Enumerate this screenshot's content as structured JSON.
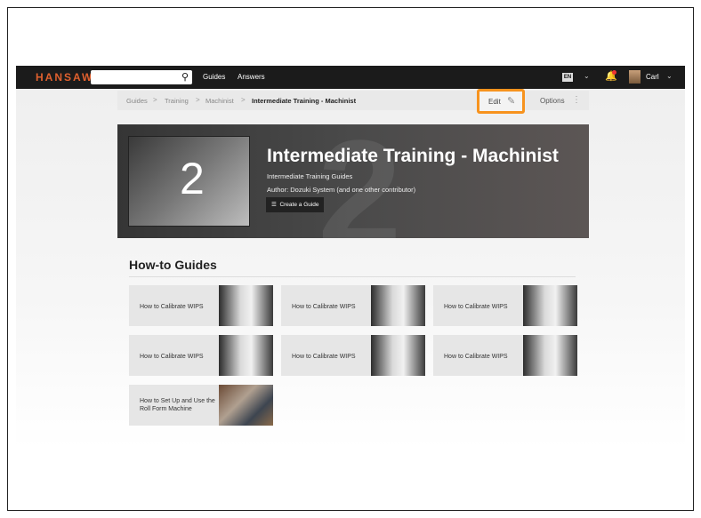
{
  "topbar": {
    "logo": "HANSAW",
    "nav": [
      "Guides",
      "Answers"
    ],
    "lang": "EN",
    "user": "Carl"
  },
  "breadcrumb": [
    "Guides",
    "Training",
    "Machinist",
    "Intermediate Training - Machinist"
  ],
  "toolbar": {
    "edit": "Edit",
    "options": "Options"
  },
  "hero": {
    "title": "Intermediate Training - Machinist",
    "subtitle": "Intermediate Training Guides",
    "author": "Author: Dozuki System (and one other contributor)",
    "create_btn": "Create a Guide",
    "number": "2"
  },
  "section": {
    "title": "How-to Guides"
  },
  "guides": [
    "How to Calibrate WIPS",
    "How to Calibrate WIPS",
    "How to Calibrate WIPS",
    "How to Calibrate WIPS",
    "How to Calibrate WIPS",
    "How to Calibrate WIPS",
    "How to Set Up and Use the Roll Form Machine"
  ],
  "colors": {
    "accent": "#f7931e",
    "brand": "#e0602e",
    "topbar": "#1b1b1b"
  }
}
